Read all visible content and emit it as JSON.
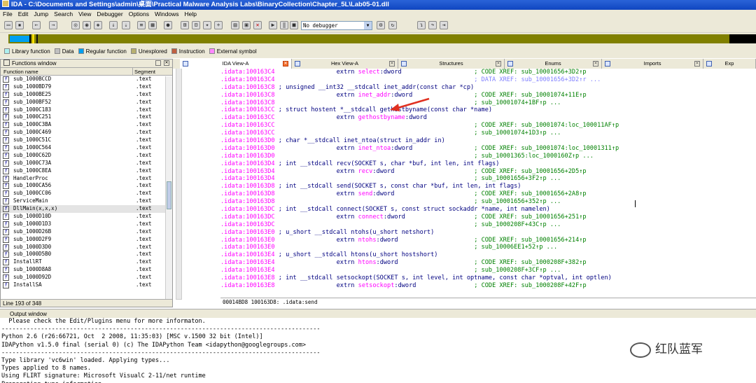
{
  "window": {
    "title": "IDA - C:\\Documents and Settings\\admin\\桌面\\Practical Malware Analysis Labs\\BinaryCollection\\Chapter_5L\\Lab05-01.dll"
  },
  "menu": [
    "File",
    "Edit",
    "Jump",
    "Search",
    "View",
    "Debugger",
    "Options",
    "Windows",
    "Help"
  ],
  "toolbar": {
    "debugger_select": "No debugger"
  },
  "legend": [
    {
      "label": "Library function",
      "color": "#aef0f0"
    },
    {
      "label": "Data",
      "color": "#c0c0c0"
    },
    {
      "label": "Regular function",
      "color": "#00a0f0"
    },
    {
      "label": "Unexplored",
      "color": "#b8b070"
    },
    {
      "label": "Instruction",
      "color": "#c06040"
    },
    {
      "label": "External symbol",
      "color": "#ff88ff"
    }
  ],
  "functions_window": {
    "title": "Functions window",
    "col_name": "Function name",
    "col_segment": "Segment",
    "status": "Line 193 of 348",
    "rows": [
      {
        "name": "sub_1000BCCD",
        "seg": ".text"
      },
      {
        "name": "sub_1000BD79",
        "seg": ".text"
      },
      {
        "name": "sub_1000BE25",
        "seg": ".text"
      },
      {
        "name": "sub_1000BF52",
        "seg": ".text"
      },
      {
        "name": "sub_1000C183",
        "seg": ".text"
      },
      {
        "name": "sub_1000C251",
        "seg": ".text"
      },
      {
        "name": "sub_1000C3BA",
        "seg": ".text"
      },
      {
        "name": "sub_1000C469",
        "seg": ".text"
      },
      {
        "name": "sub_1000C51C",
        "seg": ".text"
      },
      {
        "name": "sub_1000C564",
        "seg": ".text"
      },
      {
        "name": "sub_1000C62D",
        "seg": ".text"
      },
      {
        "name": "sub_1000C73A",
        "seg": ".text"
      },
      {
        "name": "sub_1000C8EA",
        "seg": ".text"
      },
      {
        "name": "HandlerProc",
        "seg": ".text"
      },
      {
        "name": "sub_1000CA56",
        "seg": ".text"
      },
      {
        "name": "sub_1000CC06",
        "seg": ".text"
      },
      {
        "name": "ServiceMain",
        "seg": ".text"
      },
      {
        "name": "DllMain(x,x,x)",
        "seg": ".text"
      },
      {
        "name": "sub_1000D10D",
        "seg": ".text"
      },
      {
        "name": "sub_1000D1D3",
        "seg": ".text"
      },
      {
        "name": "sub_1000D26B",
        "seg": ".text"
      },
      {
        "name": "sub_1000D2F9",
        "seg": ".text"
      },
      {
        "name": "sub_1000D3D0",
        "seg": ".text"
      },
      {
        "name": "sub_1000D5B0",
        "seg": ".text"
      },
      {
        "name": "InstallRT",
        "seg": ".text"
      },
      {
        "name": "sub_1000D8A8",
        "seg": ".text"
      },
      {
        "name": "sub_1000D92D",
        "seg": ".text"
      },
      {
        "name": "InstallSA",
        "seg": ".text"
      }
    ]
  },
  "tabs": [
    {
      "label": "IDA View-A",
      "active": true
    },
    {
      "label": "Hex View-A",
      "active": false
    },
    {
      "label": "Structures",
      "active": false
    },
    {
      "label": "Enums",
      "active": false
    },
    {
      "label": "Imports",
      "active": false
    },
    {
      "label": "Exp",
      "active": false
    }
  ],
  "ida_view": {
    "lines": [
      {
        "addr": ".idata:100163C4",
        "t": "ext",
        "name": "select",
        "cm": "; CODE XREF: sub_10001656+3D2↑p"
      },
      {
        "addr": ".idata:100163C4",
        "t": "cmt",
        "cm": "; DATA XREF: sub_10001656+3D2↑r ..."
      },
      {
        "addr": ".idata:100163C8",
        "t": "decl",
        "text": "; unsigned __int32 __stdcall inet_addr(const char *cp)"
      },
      {
        "addr": ".idata:100163C8",
        "t": "ext",
        "name": "inet_addr",
        "cm": "; CODE XREF: sub_10001074+11E↑p"
      },
      {
        "addr": ".idata:100163C8",
        "t": "cmt",
        "cm": "; sub_10001074+1BF↑p ..."
      },
      {
        "addr": ".idata:100163CC",
        "t": "decl",
        "text": "; struct hostent *__stdcall gethostbyname(const char *name)"
      },
      {
        "addr": ".idata:100163CC",
        "t": "ext",
        "name": "gethostbyname",
        "cm": ""
      },
      {
        "addr": ".idata:100163CC",
        "t": "cmt",
        "cm": "; CODE XREF: sub_10001074:loc_100011AF↑p"
      },
      {
        "addr": ".idata:100163CC",
        "t": "cmt",
        "cm": "; sub_10001074+1D3↑p ..."
      },
      {
        "addr": ".idata:100163D0",
        "t": "decl",
        "text": "; char *__stdcall inet_ntoa(struct in_addr in)"
      },
      {
        "addr": ".idata:100163D0",
        "t": "ext",
        "name": "inet_ntoa",
        "cm": "; CODE XREF: sub_10001074:loc_10001311↑p"
      },
      {
        "addr": ".idata:100163D0",
        "t": "cmt",
        "cm": "; sub_10001365:loc_1000160Z↑p ..."
      },
      {
        "addr": ".idata:100163D4",
        "t": "decl",
        "text": "; int __stdcall recv(SOCKET s, char *buf, int len, int flags)"
      },
      {
        "addr": ".idata:100163D4",
        "t": "ext",
        "name": "recv",
        "cm": "; CODE XREF: sub_10001656+2D5↑p"
      },
      {
        "addr": ".idata:100163D4",
        "t": "cmt",
        "cm": "; sub_10001656+3F2↑p ..."
      },
      {
        "addr": ".idata:100163D8",
        "t": "decl",
        "text": "; int __stdcall send(SOCKET s, const char *buf, int len, int flags)"
      },
      {
        "addr": ".idata:100163D8",
        "t": "ext",
        "name": "send",
        "cm": "; CODE XREF: sub_10001656+2A8↑p"
      },
      {
        "addr": ".idata:100163D8",
        "t": "cmt",
        "cm": "; sub_10001656+352↑p ..."
      },
      {
        "addr": ".idata:100163DC",
        "t": "decl",
        "text": "; int __stdcall connect(SOCKET s, const struct sockaddr *name, int namelen)"
      },
      {
        "addr": ".idata:100163DC",
        "t": "ext",
        "name": "connect",
        "cm": "; CODE XREF: sub_10001656+251↑p"
      },
      {
        "addr": ".idata:100163DC",
        "t": "cmt",
        "cm": "; sub_1000208F+43C↑p ..."
      },
      {
        "addr": ".idata:100163E0",
        "t": "decl",
        "text": "; u_short __stdcall ntohs(u_short netshort)"
      },
      {
        "addr": ".idata:100163E0",
        "t": "ext",
        "name": "ntohs",
        "cm": "; CODE XREF: sub_10001656+214↑p"
      },
      {
        "addr": ".idata:100163E0",
        "t": "cmt",
        "cm": "; sub_10006EE1+52↑p ..."
      },
      {
        "addr": ".idata:100163E4",
        "t": "decl",
        "text": "; u_short __stdcall htons(u_short hostshort)"
      },
      {
        "addr": ".idata:100163E4",
        "t": "ext",
        "name": "htons",
        "cm": "; CODE XREF: sub_1000208F+382↑p"
      },
      {
        "addr": ".idata:100163E4",
        "t": "cmt",
        "cm": "; sub_1000208F+3CF↑p ..."
      },
      {
        "addr": ".idata:100163E8",
        "t": "decl",
        "text": "; int __stdcall setsockopt(SOCKET s, int level, int optname, const char *optval, int optlen)"
      },
      {
        "addr": ".idata:100163E8",
        "t": "ext",
        "name": "setsockopt",
        "cm": "; CODE XREF: sub_1000208F+42F↑p"
      }
    ],
    "status": "00014BD8 100163D8: .idata:send"
  },
  "output_window": {
    "title": "Output window",
    "lines": [
      "  Please check the Edit/Plugins menu for more informaton.",
      "-----------------------------------------------------------------------------------------",
      "Python 2.6 (r26:66721, Oct  2 2008, 11:35:03) [MSC v.1500 32 bit (Intel)]",
      "IDAPython v1.5.0 final (serial 0) (c) The IDAPython Team <idapython@googlegroups.com>",
      "-----------------------------------------------------------------------------------------",
      "Type library 'vc6win' loaded. Applying types...",
      "Types applied to 8 names.",
      "Using FLIRT signature: Microsoft VisualC 2-11/net runtime",
      "Propagating type information..."
    ]
  },
  "watermark": "红队蓝军"
}
